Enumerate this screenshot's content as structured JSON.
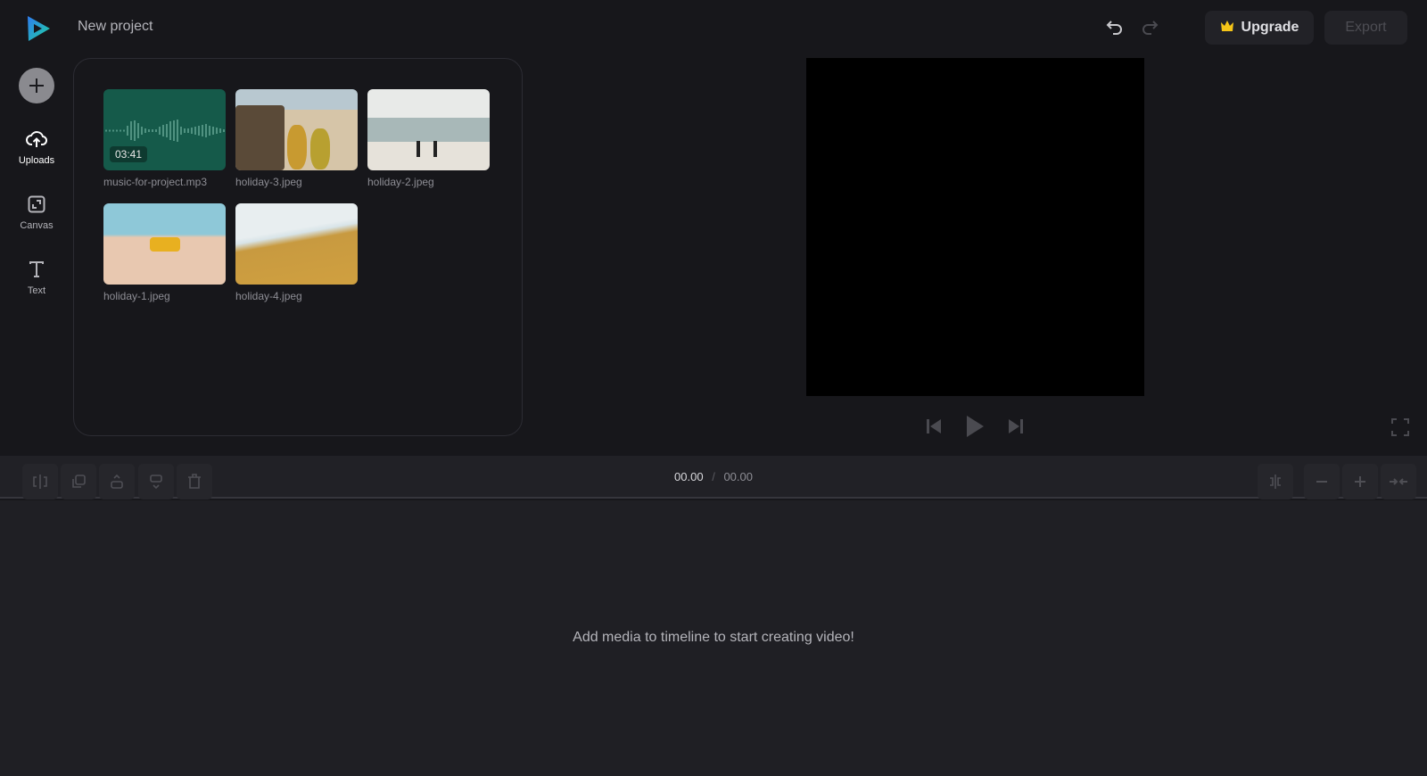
{
  "header": {
    "title": "New project",
    "upgrade_label": "Upgrade",
    "export_label": "Export"
  },
  "sidebar": {
    "items": [
      {
        "label": "Uploads"
      },
      {
        "label": "Canvas"
      },
      {
        "label": "Text"
      }
    ]
  },
  "media": [
    {
      "name": "music-for-project.mp3",
      "type": "audio",
      "duration": "03:41"
    },
    {
      "name": "holiday-3.jpeg",
      "type": "image"
    },
    {
      "name": "holiday-2.jpeg",
      "type": "image"
    },
    {
      "name": "holiday-1.jpeg",
      "type": "image"
    },
    {
      "name": "holiday-4.jpeg",
      "type": "image"
    }
  ],
  "timeline": {
    "current_time": "00.00",
    "separator": "/",
    "total_time": "00.00",
    "empty_message": "Add media to timeline to start creating video!"
  },
  "colors": {
    "accent": "#f5c518",
    "audio_bg": "#155a4a",
    "background": "#17171b"
  }
}
